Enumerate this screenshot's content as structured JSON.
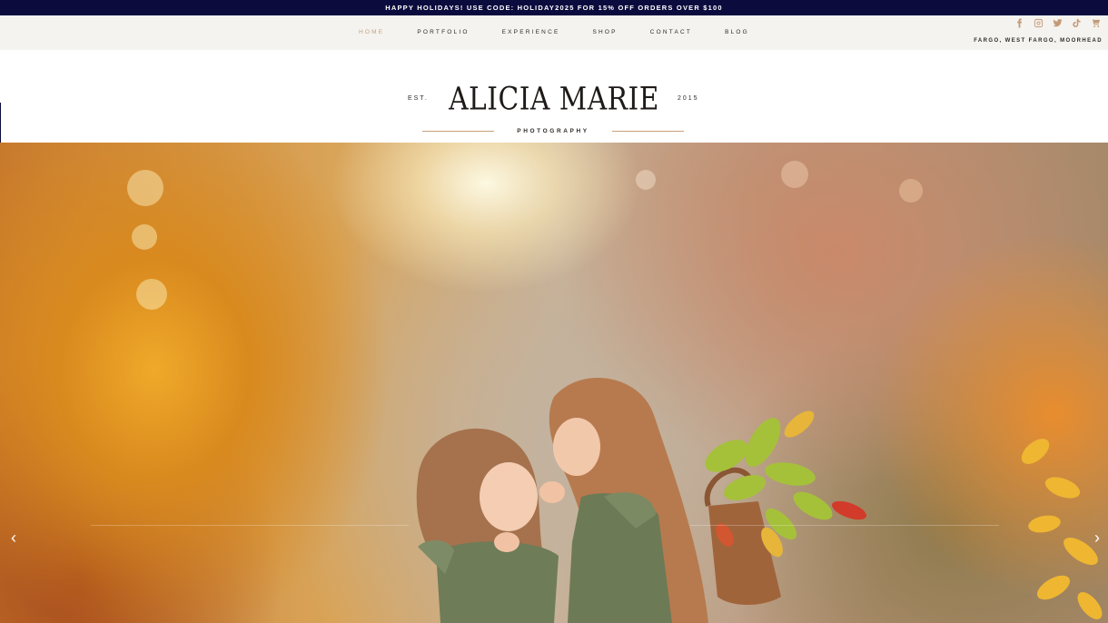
{
  "promo": {
    "text": "HAPPY HOLIDAYS! USE CODE: HOLIDAY2025 FOR 15% OFF ORDERS OVER $100"
  },
  "nav": {
    "items": [
      {
        "label": "HOME",
        "active": true
      },
      {
        "label": "PORTFOLIO",
        "active": false
      },
      {
        "label": "EXPERIENCE",
        "active": false
      },
      {
        "label": "SHOP",
        "active": false
      },
      {
        "label": "CONTACT",
        "active": false
      },
      {
        "label": "BLOG",
        "active": false
      }
    ],
    "location": "FARGO, WEST FARGO, MOORHEAD",
    "social_icons": [
      "facebook-icon",
      "instagram-icon",
      "twitter-icon",
      "tiktok-icon",
      "cart-icon"
    ]
  },
  "logo": {
    "est": "EST.",
    "name": "ALICIA MARIE",
    "year": "2015",
    "subtitle": "PHOTOGRAPHY"
  },
  "hero": {
    "prev_arrow": "‹",
    "next_arrow": "›"
  },
  "colors": {
    "promo_bg": "#0b0b3e",
    "accent": "#c9a07a",
    "nav_bg": "#f4f3f0"
  }
}
